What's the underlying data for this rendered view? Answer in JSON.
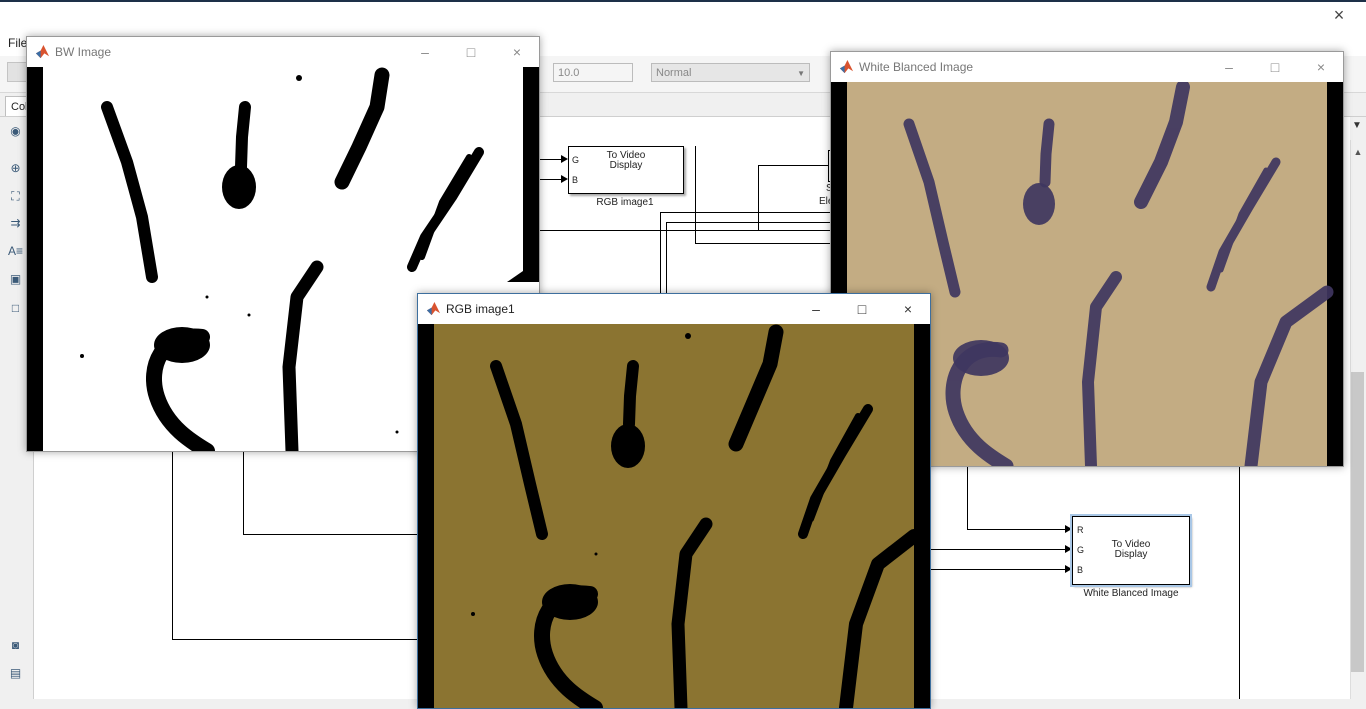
{
  "main_window": {
    "menu": {
      "file": "File"
    },
    "toolbar": {
      "stop_time": "10.0",
      "sim_mode": "Normal"
    },
    "tab": {
      "label": "Col"
    }
  },
  "blocks": {
    "rgb_display": {
      "title_line1": "To Video",
      "title_line2": "Display",
      "ports": [
        "G",
        "B"
      ],
      "label": "RGB image1"
    },
    "partial_block": {
      "label_top": "S",
      "label": "Ele"
    },
    "wb_display": {
      "title_line1": "To Video",
      "title_line2": "Display",
      "ports": [
        "R",
        "G",
        "B"
      ],
      "label": "White Blanced Image"
    }
  },
  "windows": {
    "bw": {
      "title": "BW Image"
    },
    "wb": {
      "title": "White Blanced Image"
    },
    "rgb": {
      "title": "RGB image1"
    }
  },
  "colors": {
    "rgb_bg": "#8b7431",
    "wb_bg": "#c3ac83",
    "wb_stroke": "#3f3660",
    "bw_bg": "#ffffff",
    "accent": "#3d6f9e"
  },
  "icons": {
    "close": "×",
    "minimize": "–",
    "maximize": "□"
  }
}
